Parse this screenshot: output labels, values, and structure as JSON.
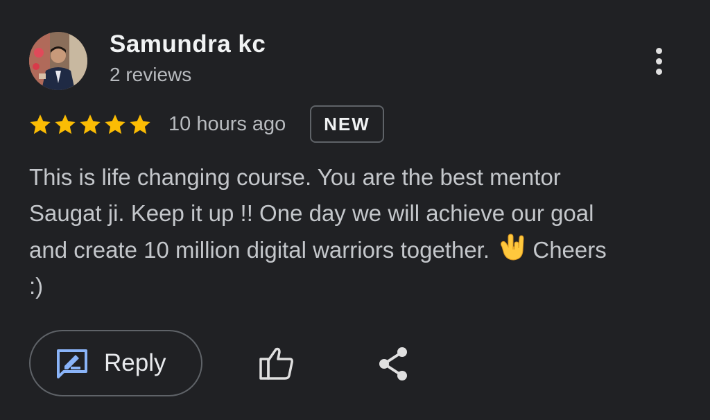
{
  "reviewer": {
    "name": "Samundra kc",
    "review_count": "2 reviews"
  },
  "rating": {
    "stars": 5,
    "max_stars": 5,
    "star_color": "#fbbc04"
  },
  "timestamp": "10 hours ago",
  "badge": "NEW",
  "review": {
    "line1": "This is life changing course. You are the best mentor",
    "line2": "Saugat ji. Keep it up !! One day we will achieve our goal",
    "line3_before_emoji": "and create 10 million digital warriors together.",
    "line3_after_emoji": "Cheers",
    "line4": ":)",
    "emoji": "love-you-gesture-emoji"
  },
  "actions": {
    "reply_label": "Reply",
    "reply_icon": "rate-review-icon",
    "like_icon": "thumb-up-icon",
    "share_icon": "share-icon",
    "more_icon": "more-vert-icon"
  },
  "colors": {
    "background": "#202124",
    "accent_blue": "#8ab4f8"
  }
}
